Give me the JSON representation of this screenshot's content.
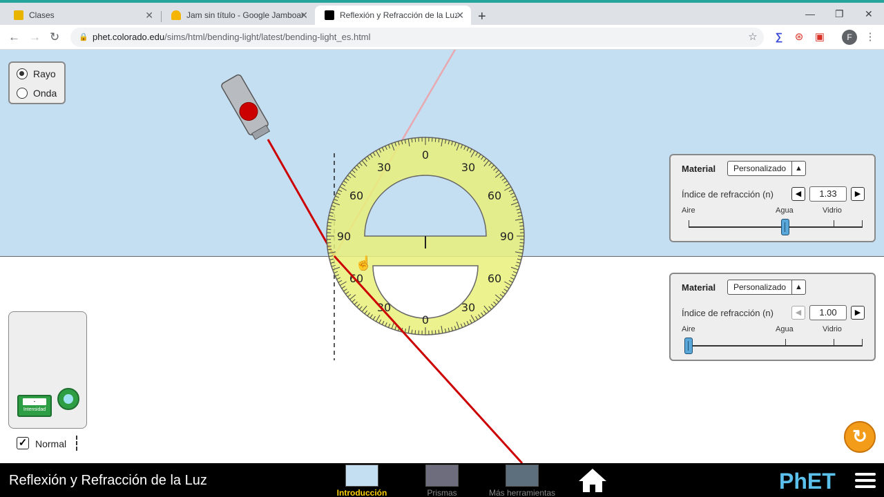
{
  "browser": {
    "tabs": [
      {
        "title": "Clases",
        "favicon_color": "#e8b400"
      },
      {
        "title": "Jam sin título - Google Jamboard",
        "favicon_color": "#f4b400"
      },
      {
        "title": "Reflexión y Refracción de la Luz",
        "favicon_color": "#000000"
      }
    ],
    "active_tab": 2,
    "url_host": "phet.colorado.edu",
    "url_path": "/sims/html/bending-light/latest/bending-light_es.html",
    "profile_initial": "F"
  },
  "view_mode": {
    "options": [
      "Rayo",
      "Onda"
    ],
    "selected": "Rayo"
  },
  "protractor": {
    "top_labels": [
      "0",
      "30",
      "30",
      "60",
      "60",
      "90",
      "90"
    ],
    "bottom_labels": [
      "60",
      "60",
      "30",
      "30",
      "0"
    ]
  },
  "top_medium": {
    "material_label": "Material",
    "material_value": "Personalizado",
    "index_label": "Índice de refracción (n)",
    "index_value": "1.33",
    "slider_labels": [
      "Aire",
      "Agua",
      "Vidrio"
    ],
    "slider_fraction": 0.56
  },
  "bottom_medium": {
    "material_label": "Material",
    "material_value": "Personalizado",
    "index_label": "Índice de refracción (n)",
    "index_value": "1.00",
    "slider_labels": [
      "Aire",
      "Agua",
      "Vidrio"
    ],
    "slider_fraction": 0.0
  },
  "toolbox": {
    "intensity_label": "Intensidad",
    "normal_label": "Normal",
    "normal_checked": true
  },
  "navbar": {
    "title": "Reflexión y Refracción de la Luz",
    "screens": [
      "Introducción",
      "Prismas",
      "Más herramientas"
    ],
    "active_screen": "Introducción",
    "logo": "PhET"
  },
  "colors": {
    "air": "#c5dff2",
    "laser_beam": "#cc0000",
    "protractor": "#e8f07a",
    "reset": "#f39c1a"
  }
}
